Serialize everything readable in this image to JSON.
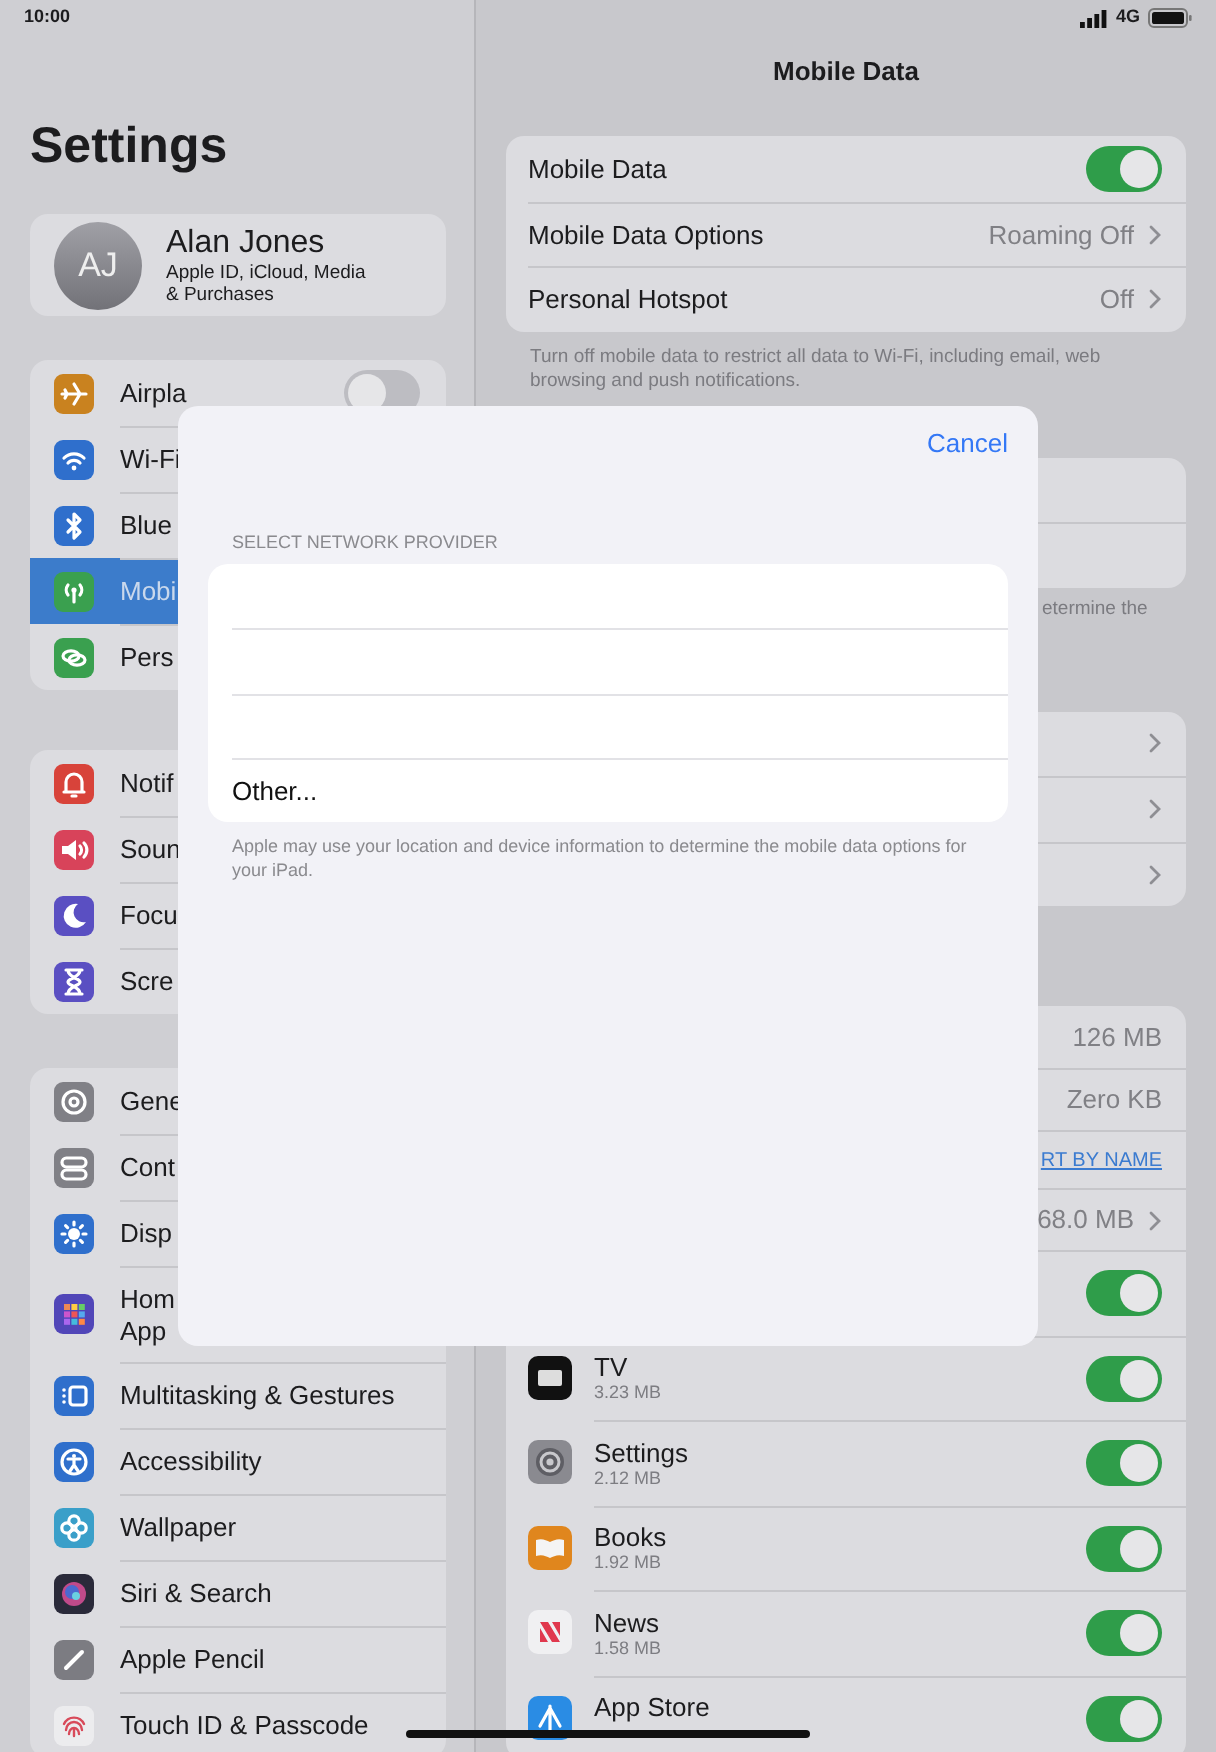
{
  "status_bar": {
    "time": "10:00",
    "network": "4G"
  },
  "sidebar": {
    "title": "Settings",
    "profile": {
      "initials": "AJ",
      "name": "Alan Jones",
      "subtitle": "Apple ID, iCloud, Media & Purchases"
    },
    "groups": [
      {
        "items": [
          {
            "label": "Airpla",
            "kind": "toggle",
            "on": false,
            "selected": false
          },
          {
            "label": "Wi-Fi",
            "kind": "link",
            "selected": false
          },
          {
            "label": "Blue",
            "kind": "link",
            "selected": false
          },
          {
            "label": "Mobi",
            "kind": "link",
            "selected": true
          },
          {
            "label": "Pers",
            "kind": "link",
            "selected": false
          }
        ]
      },
      {
        "items": [
          {
            "label": "Notif",
            "kind": "link",
            "selected": false
          },
          {
            "label": "Soun",
            "kind": "link",
            "selected": false
          },
          {
            "label": "Focu",
            "kind": "link",
            "selected": false
          },
          {
            "label": "Scre",
            "kind": "link",
            "selected": false
          }
        ]
      },
      {
        "items": [
          {
            "label": "Gene",
            "kind": "link",
            "selected": false
          },
          {
            "label": "Cont",
            "kind": "link",
            "selected": false
          },
          {
            "label": "Disp",
            "kind": "link",
            "selected": false
          },
          {
            "label": "Hom\nApp",
            "kind": "tall",
            "selected": false
          },
          {
            "label": "Multitasking & Gestures",
            "kind": "link",
            "selected": false
          },
          {
            "label": "Accessibility",
            "kind": "link",
            "selected": false
          },
          {
            "label": "Wallpaper",
            "kind": "link",
            "selected": false
          },
          {
            "label": "Siri & Search",
            "kind": "link",
            "selected": false
          },
          {
            "label": "Apple Pencil",
            "kind": "link",
            "selected": false
          },
          {
            "label": "Touch ID & Passcode",
            "kind": "link",
            "selected": false
          }
        ]
      }
    ]
  },
  "detail": {
    "title": "Mobile Data",
    "groups": [
      {
        "rows": [
          {
            "kind": "toggle",
            "label": "Mobile Data",
            "on": true
          },
          {
            "kind": "link",
            "label": "Mobile Data Options",
            "value": "Roaming Off"
          },
          {
            "kind": "link",
            "label": "Personal Hotspot",
            "value": "Off"
          }
        ],
        "footer": {
          "kind": "full",
          "text": "Turn off mobile data to restrict all data to Wi-Fi, including email, web browsing and push notifications."
        }
      },
      {
        "rows": [
          {
            "kind": "blank"
          },
          {
            "kind": "blank"
          }
        ],
        "footer": {
          "kind": "partial",
          "text": "etermine the"
        }
      },
      {
        "rows": [
          {
            "kind": "link"
          },
          {
            "kind": "link"
          },
          {
            "kind": "link"
          }
        ]
      },
      {
        "rows": [
          {
            "kind": "value",
            "value": "126 MB"
          },
          {
            "kind": "value",
            "value": "Zero KB"
          },
          {
            "kind": "action",
            "value": "RT BY NAME"
          },
          {
            "kind": "link",
            "value": "68.0 MB"
          },
          {
            "kind": "toggle",
            "on": true
          },
          {
            "kind": "app",
            "label": "TV",
            "detail": "3.23 MB",
            "on": true
          },
          {
            "kind": "app",
            "label": "Settings",
            "detail": "2.12 MB",
            "on": true
          },
          {
            "kind": "app",
            "label": "Books",
            "detail": "1.92 MB",
            "on": true
          },
          {
            "kind": "app",
            "label": "News",
            "detail": "1.58 MB",
            "on": true
          },
          {
            "kind": "app",
            "label": "App Store",
            "on": true
          }
        ]
      }
    ]
  },
  "modal": {
    "cancel": "Cancel",
    "header": "SELECT NETWORK PROVIDER",
    "rows": [
      {
        "kind": "blank"
      },
      {
        "kind": "blank"
      },
      {
        "kind": "blank"
      },
      {
        "kind": "option",
        "label": "Other..."
      }
    ],
    "footer": "Apple may use your location and device information to determine the mobile data options for your iPad."
  }
}
